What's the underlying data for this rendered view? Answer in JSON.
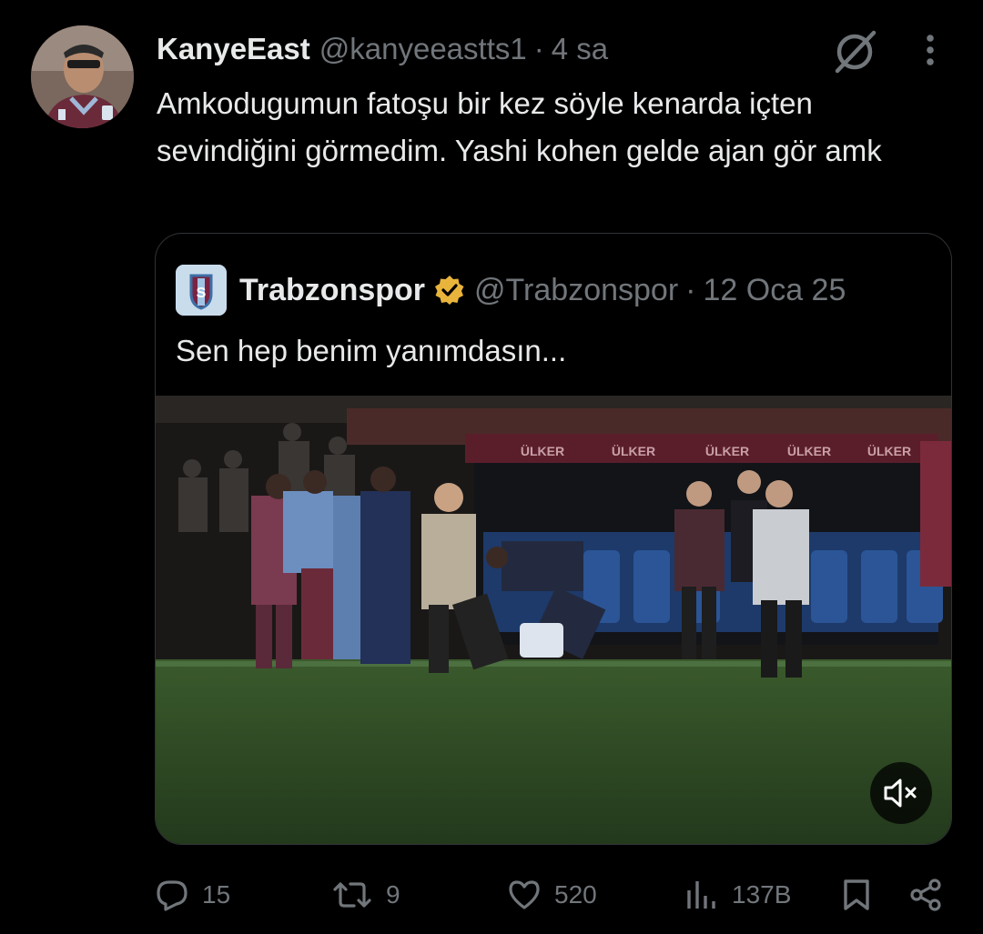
{
  "tweet": {
    "author_name": "KanyeEast",
    "author_handle": "@kanyeeastts1",
    "separator": "·",
    "time": "4 sa",
    "text": "Amkodugumun fatoşu bir kez söyle kenarda içten sevindiğini görmedim. Yashi kohen gelde ajan gör amk"
  },
  "quote": {
    "author_name": "Trabzonspor",
    "author_handle": "@Trabzonspor",
    "separator": "·",
    "date": "12 Oca 25",
    "text": "Sen hep benim yanımdasın..."
  },
  "media": {
    "stadium_banner": [
      "ÜLKER",
      "ÜLKER",
      "ÜLKER",
      "ÜLKER",
      "ÜLKER"
    ]
  },
  "actions": {
    "replies": "15",
    "retweets": "9",
    "likes": "520",
    "views": "137B"
  },
  "icons": {
    "reply": "reply-icon",
    "retweet": "retweet-icon",
    "like": "heart-icon",
    "views": "views-icon",
    "bookmark": "bookmark-icon",
    "share": "share-icon",
    "grok": "grok-icon",
    "more": "more-icon",
    "mute": "mute-icon",
    "verified": "verified-badge-icon"
  },
  "colors": {
    "background": "#000000",
    "text": "#e7e9ea",
    "secondary": "#71767b",
    "border": "#2f3336",
    "verified_gold": "#e8b43b",
    "pitch_green": "#2e4a26"
  }
}
